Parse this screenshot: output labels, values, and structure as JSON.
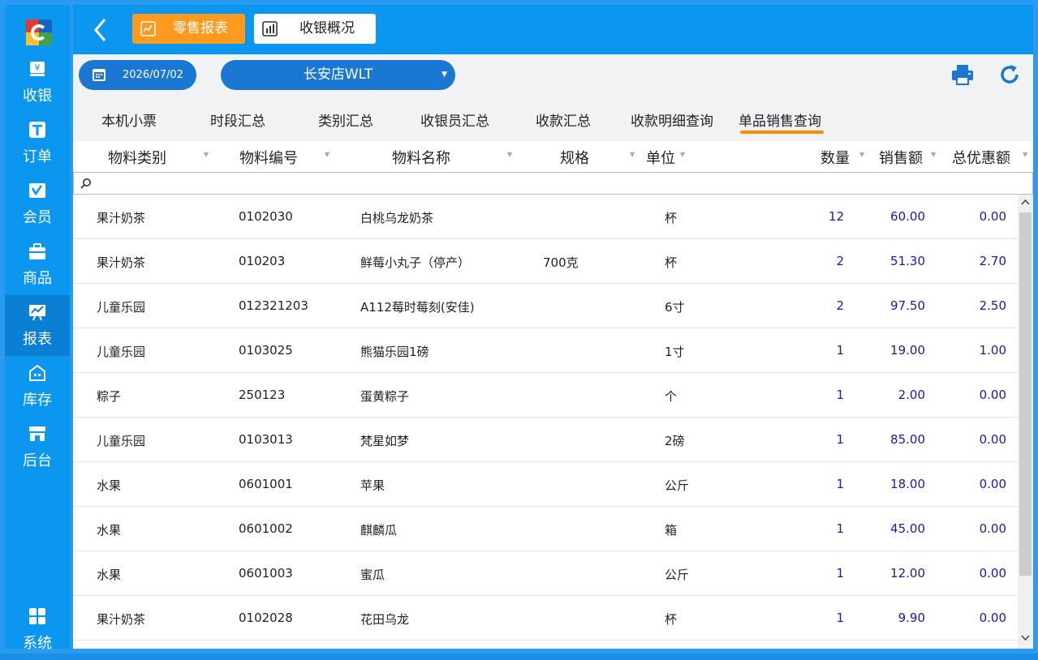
{
  "sidebar": {
    "items": [
      {
        "label": "收银",
        "icon": "cashier-icon"
      },
      {
        "label": "订单",
        "icon": "order-icon"
      },
      {
        "label": "会员",
        "icon": "member-icon"
      },
      {
        "label": "商品",
        "icon": "goods-icon"
      },
      {
        "label": "报表",
        "icon": "report-icon",
        "active": true
      },
      {
        "label": "库存",
        "icon": "warehouse-icon"
      },
      {
        "label": "后台",
        "icon": "store-icon"
      },
      {
        "label": "系统",
        "icon": "grid-icon"
      }
    ]
  },
  "topbar": {
    "tabs": [
      {
        "label": "零售报表",
        "active": true
      },
      {
        "label": "收银概况",
        "active": false
      }
    ]
  },
  "filter": {
    "date": "2026/07/02",
    "store": "长安店WLT"
  },
  "subtabs": [
    "本机小票",
    "时段汇总",
    "类别汇总",
    "收银员汇总",
    "收款汇总",
    "收款明细查询",
    "单品销售查询"
  ],
  "active_subtab": "单品销售查询",
  "table": {
    "columns": [
      "物料类别",
      "物料编号",
      "物料名称",
      "规格",
      "单位",
      "数量",
      "销售额",
      "总优惠额"
    ],
    "rows": [
      [
        "果汁奶茶",
        "0102030",
        "白桃乌龙奶茶",
        "",
        "杯",
        "12",
        "60.00",
        "0.00"
      ],
      [
        "果汁奶茶",
        "010203",
        "鲜莓小丸子（停产）",
        "700克",
        "杯",
        "2",
        "51.30",
        "2.70"
      ],
      [
        "儿童乐园",
        "012321203",
        "A112莓时莓刻(安佳)",
        "",
        "6寸",
        "2",
        "97.50",
        "2.50"
      ],
      [
        "儿童乐园",
        "0103025",
        "熊猫乐园1磅",
        "",
        "1寸",
        "1",
        "19.00",
        "1.00"
      ],
      [
        "粽子",
        "250123",
        "蛋黄粽子",
        "",
        "个",
        "1",
        "2.00",
        "0.00"
      ],
      [
        "儿童乐园",
        "0103013",
        "梵星如梦",
        "",
        "2磅",
        "1",
        "85.00",
        "0.00"
      ],
      [
        "水果",
        "0601001",
        "苹果",
        "",
        "公斤",
        "1",
        "18.00",
        "0.00"
      ],
      [
        "水果",
        "0601002",
        "麒麟瓜",
        "",
        "箱",
        "1",
        "45.00",
        "0.00"
      ],
      [
        "水果",
        "0601003",
        "蜜瓜",
        "",
        "公斤",
        "1",
        "12.00",
        "0.00"
      ],
      [
        "果汁奶茶",
        "0102028",
        "花田乌龙",
        "",
        "杯",
        "1",
        "9.90",
        "0.00"
      ]
    ]
  },
  "colors": {
    "primary": "#0b96f0",
    "accent": "#ff9a1e",
    "pill": "#1a78d2",
    "number": "#1a1aa8"
  }
}
